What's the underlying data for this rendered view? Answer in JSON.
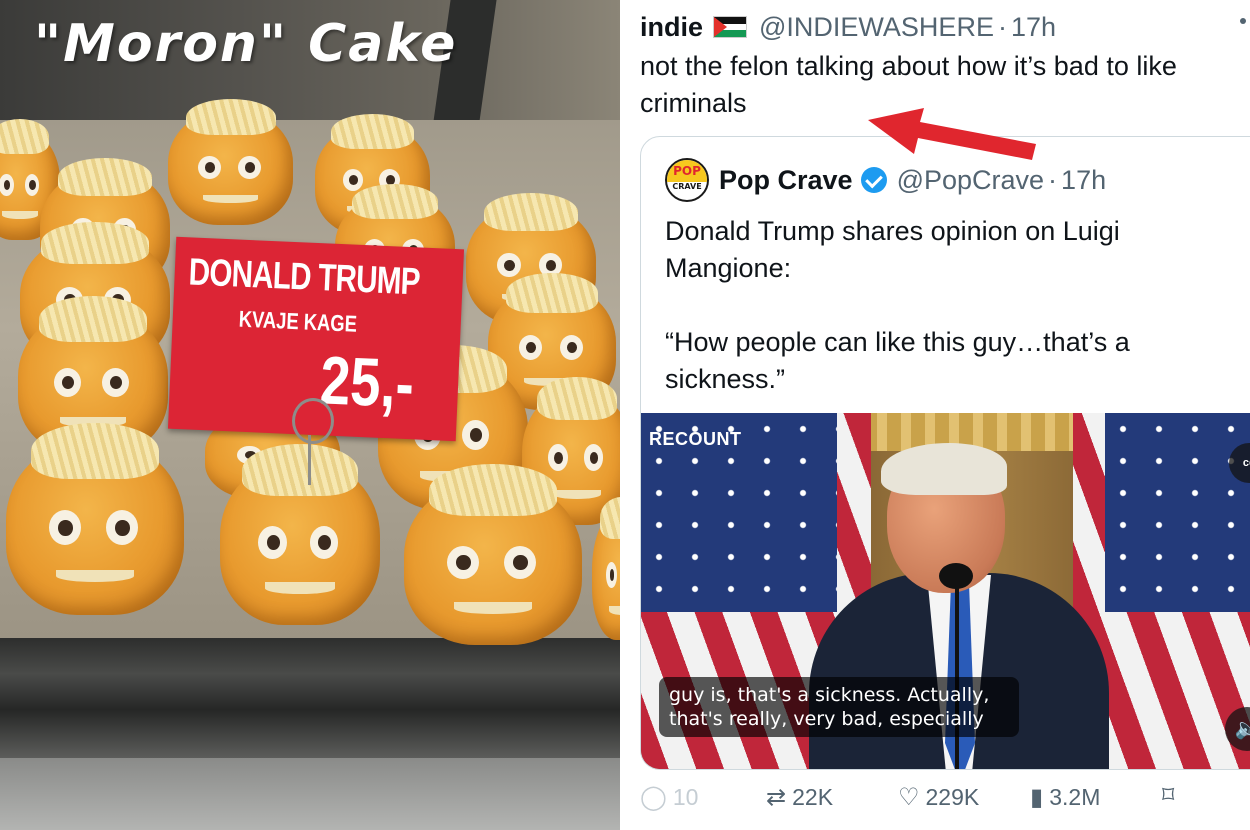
{
  "photo": {
    "caption": "\"Moron\" Cake",
    "sign_title": "DONALD TRUMP",
    "sign_subtitle": "KVAJE KAGE",
    "sign_price": "25,-"
  },
  "tweet": {
    "name": "indie",
    "handle": "@INDIEWASHERE",
    "separator": "·",
    "time": "17h",
    "text": "not the felon talking about how it’s bad to like criminals",
    "quote": {
      "avatar_label": "POP",
      "avatar_sublabel": "CRAVE",
      "name": "Pop Crave",
      "handle": "@PopCrave",
      "separator": "·",
      "time": "17h",
      "text_line1": "Donald Trump shares opinion on Luigi Mangione:",
      "text_line2": "“How people can like this guy…that’s a sickness.”",
      "video": {
        "logo": "RECOUNT",
        "subtitle": "guy is, that's a sickness. Actually,\nthat's really, very bad, especially",
        "cc_label": "cc",
        "mute_icon": "speaker-icon"
      }
    },
    "actions": {
      "replies": "10",
      "reposts": "22K",
      "likes": "229K",
      "views": "3.2M"
    }
  },
  "colors": {
    "sign_red": "#dc2535",
    "verified_blue": "#1d9bf0",
    "arrow_red": "#e0262e",
    "text_secondary": "#536471"
  }
}
